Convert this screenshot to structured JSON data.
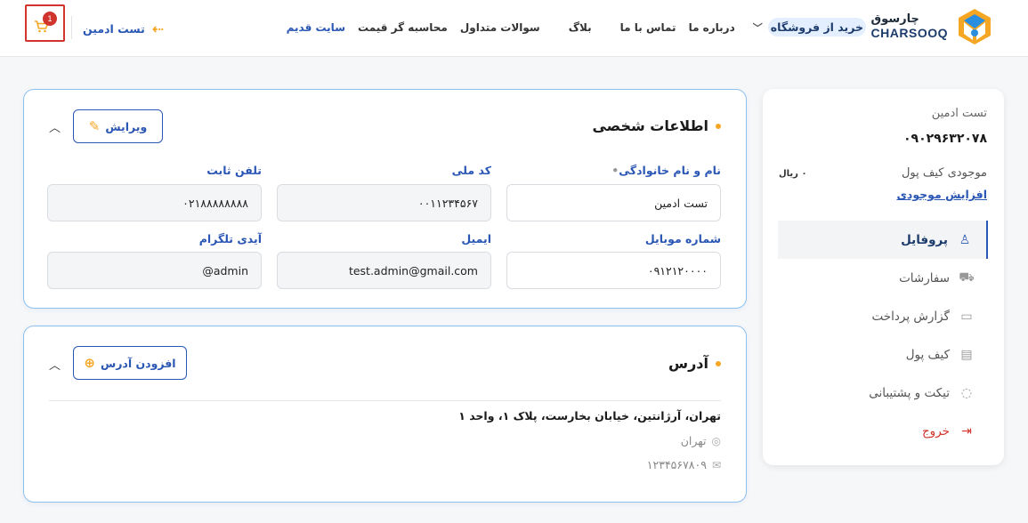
{
  "header": {
    "logo_fa": "چارسوق",
    "logo_en": "CHARSOOQ",
    "nav": {
      "shop": "خرید از فروشگاه",
      "about": "درباره ما",
      "contact": "تماس با ما",
      "blog": "بلاگ",
      "faq": "سوالات متداول",
      "calculator": "محاسبه گر قیمت",
      "old_site": "سایت قدیم"
    },
    "user_name": "تست ادمین",
    "cart_count": "1"
  },
  "sidebar": {
    "name": "تست ادمین",
    "phone": "۰۹۰۲۹۶۳۲۰۷۸",
    "wallet_label": "موجودی کیف پول",
    "wallet_value": "۰ ریال",
    "topup": "افزایش موجودی",
    "menu": [
      {
        "label": "پروفایل",
        "icon": "user-icon"
      },
      {
        "label": "سفارشات",
        "icon": "cart-icon"
      },
      {
        "label": "گزارش پرداخت",
        "icon": "payment-icon"
      },
      {
        "label": "کیف پول",
        "icon": "wallet-icon"
      },
      {
        "label": "تیکت و پشتیبانی",
        "icon": "chat-icon"
      },
      {
        "label": "خروج",
        "icon": "logout-icon"
      }
    ]
  },
  "personal": {
    "title": "اطلاعات شخصی",
    "edit": "ویرایش",
    "fields": {
      "fullname_label": "نام و نام خانوادگی",
      "fullname": "تست ادمین",
      "national_label": "کد ملی",
      "national": "۰۰۱۱۲۳۴۵۶۷",
      "landline_label": "تلفن ثابت",
      "landline": "۰۲۱۸۸۸۸۸۸۸۸",
      "mobile_label": "شماره موبایل",
      "mobile": "۰۹۱۲۱۲۰۰۰۰",
      "email_label": "ایمیل",
      "email": "test.admin@gmail.com",
      "telegram_label": "آیدی تلگرام",
      "telegram": "admin@"
    }
  },
  "address": {
    "title": "آدرس",
    "add": "افزودن آدرس",
    "line": "تهران، آرژانتین، خیابان بخارست، پلاک ۱، واحد ۱",
    "city": "تهران",
    "postal": "۱۲۳۴۵۶۷۸۰۹"
  },
  "colors": {
    "accent": "#2a56b4",
    "highlight": "#f5a623",
    "danger": "#d0342c",
    "card_border": "#8ec0ee"
  }
}
